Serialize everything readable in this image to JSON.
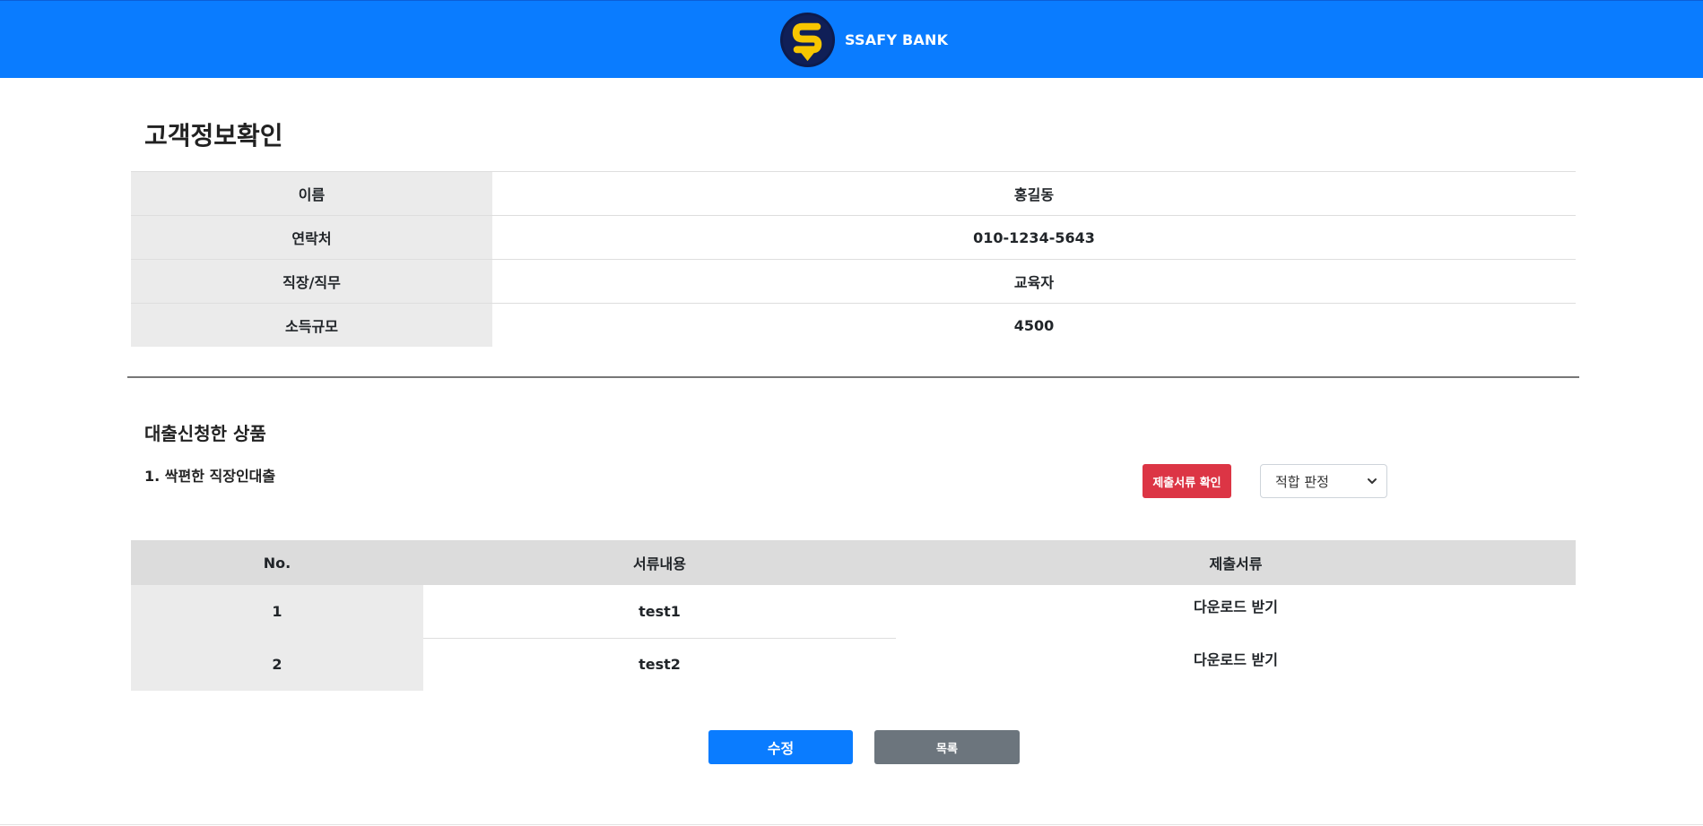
{
  "brand": {
    "name": "SSAFY BANK",
    "logo_icon": "ssafy-s-logo"
  },
  "colors": {
    "navbar": "#0a7cff",
    "danger": "#dc3545",
    "secondary": "#6c757d"
  },
  "page_title": "고객정보확인",
  "customer": {
    "rows": [
      {
        "label": "이름",
        "value": "홍길동"
      },
      {
        "label": "연락처",
        "value": "010-1234-5643"
      },
      {
        "label": "직장/직무",
        "value": "교육자"
      },
      {
        "label": "소득규모",
        "value": "4500"
      }
    ]
  },
  "loan_section": {
    "title": "대출신청한 상품",
    "product": "1. 싹편한 직장인대출",
    "docs_button": "제출서류 확인",
    "judgement_select": {
      "selected": "적합 판정"
    }
  },
  "documents": {
    "headers": {
      "no": "No.",
      "content": "서류내용",
      "file": "제출서류"
    },
    "rows": [
      {
        "no": "1",
        "content": "test1",
        "file": "다운로드 받기"
      },
      {
        "no": "2",
        "content": "test2",
        "file": "다운로드 받기"
      }
    ]
  },
  "actions": {
    "edit": "수정",
    "list": "목록"
  }
}
